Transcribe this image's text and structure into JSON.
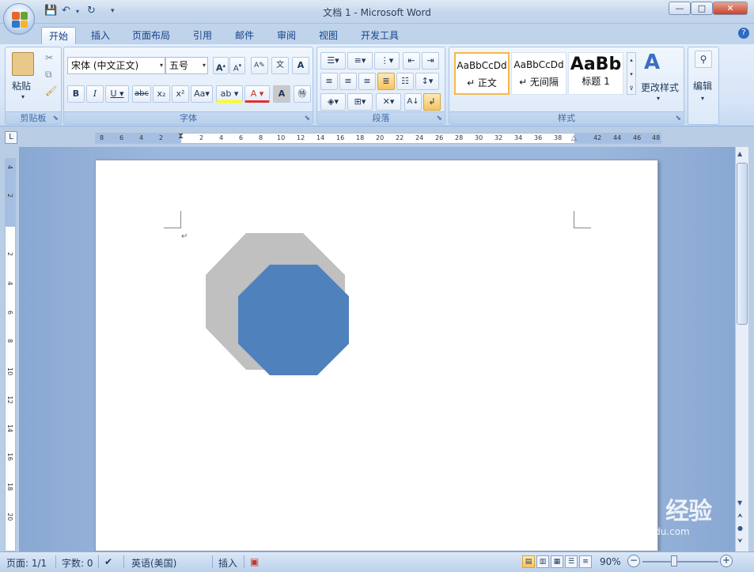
{
  "window": {
    "title": "文档 1 - Microsoft Word"
  },
  "tabs": [
    "开始",
    "插入",
    "页面布局",
    "引用",
    "邮件",
    "审阅",
    "视图",
    "开发工具"
  ],
  "ribbon": {
    "clipboard": {
      "label": "剪贴板",
      "paste": "粘贴"
    },
    "font": {
      "label": "字体",
      "font_name": "宋体 (中文正文)",
      "font_size": "五号"
    },
    "paragraph": {
      "label": "段落"
    },
    "styles": {
      "label": "样式",
      "items": [
        {
          "preview": "AaBbCcDd",
          "name": "↵ 正文"
        },
        {
          "preview": "AaBbCcDd",
          "name": "↵ 无间隔"
        },
        {
          "preview": "AaBb",
          "name": "标题 1"
        }
      ],
      "change_styles": "更改样式"
    },
    "editing": {
      "label": "编辑"
    }
  },
  "ruler_h": [
    "8",
    "6",
    "4",
    "2",
    "2",
    "4",
    "6",
    "8",
    "10",
    "12",
    "14",
    "16",
    "18",
    "20",
    "22",
    "24",
    "26",
    "28",
    "30",
    "32",
    "34",
    "36",
    "38",
    "42",
    "44",
    "46",
    "48"
  ],
  "ruler_v": [
    "4",
    "2",
    "2",
    "4",
    "6",
    "8",
    "10",
    "12",
    "14",
    "16",
    "18",
    "20"
  ],
  "document": {
    "shapes": [
      {
        "type": "octagon",
        "color": "#c0c0c0"
      },
      {
        "type": "octagon",
        "color": "#4f81bd"
      }
    ]
  },
  "status": {
    "page": "页面: 1/1",
    "words": "字数: 0",
    "language": "英语(美国)",
    "mode": "插入",
    "zoom": "90%"
  },
  "watermark": {
    "logo": "Bai du 经验",
    "sub": "jingyan.baidu.com"
  }
}
